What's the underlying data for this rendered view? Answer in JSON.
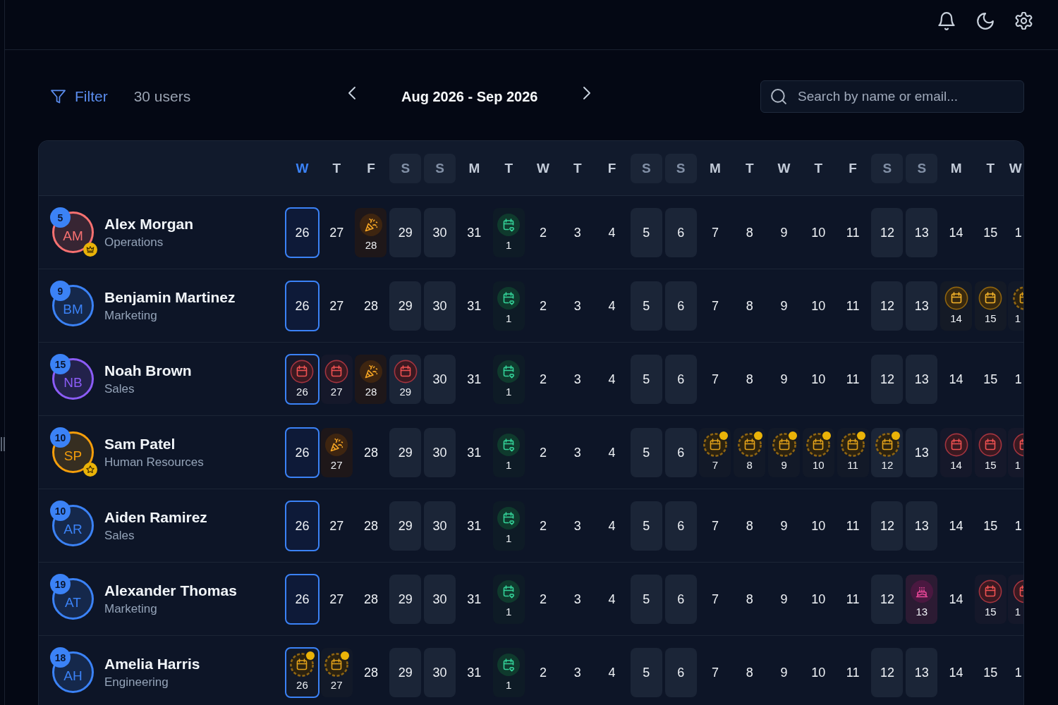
{
  "toolbar": {
    "filter_label": "Filter",
    "user_count": "30 users",
    "date_range": "Aug 2026 - Sep 2026",
    "search": {
      "placeholder": "Search by name or email..."
    }
  },
  "days": [
    {
      "letter": "W",
      "weekend": false,
      "today": true
    },
    {
      "letter": "T",
      "weekend": false,
      "today": false
    },
    {
      "letter": "F",
      "weekend": false,
      "today": false
    },
    {
      "letter": "S",
      "weekend": true,
      "today": false
    },
    {
      "letter": "S",
      "weekend": true,
      "today": false
    },
    {
      "letter": "M",
      "weekend": false,
      "today": false
    },
    {
      "letter": "T",
      "weekend": false,
      "today": false
    },
    {
      "letter": "W",
      "weekend": false,
      "today": false
    },
    {
      "letter": "T",
      "weekend": false,
      "today": false
    },
    {
      "letter": "F",
      "weekend": false,
      "today": false
    },
    {
      "letter": "S",
      "weekend": true,
      "today": false
    },
    {
      "letter": "S",
      "weekend": true,
      "today": false
    },
    {
      "letter": "M",
      "weekend": false,
      "today": false
    },
    {
      "letter": "T",
      "weekend": false,
      "today": false
    },
    {
      "letter": "W",
      "weekend": false,
      "today": false
    },
    {
      "letter": "T",
      "weekend": false,
      "today": false
    },
    {
      "letter": "F",
      "weekend": false,
      "today": false
    },
    {
      "letter": "S",
      "weekend": true,
      "today": false
    },
    {
      "letter": "S",
      "weekend": true,
      "today": false
    },
    {
      "letter": "M",
      "weekend": false,
      "today": false
    },
    {
      "letter": "T",
      "weekend": false,
      "today": false
    },
    {
      "letter": "W",
      "weekend": false,
      "today": false
    }
  ],
  "users": [
    {
      "initials": "AM",
      "name": "Alex Morgan",
      "department": "Operations",
      "count": "5",
      "color": "#f87171",
      "role_badge": {
        "kind": "crown"
      },
      "cells": [
        {
          "day": "26",
          "kind": "day"
        },
        {
          "day": "27",
          "kind": "day"
        },
        {
          "day": "28",
          "kind": "celebration"
        },
        {
          "day": "29",
          "kind": "day"
        },
        {
          "day": "30",
          "kind": "day"
        },
        {
          "day": "31",
          "kind": "day"
        },
        {
          "day": "1",
          "kind": "holiday"
        },
        {
          "day": "2",
          "kind": "day"
        },
        {
          "day": "3",
          "kind": "day"
        },
        {
          "day": "4",
          "kind": "day"
        },
        {
          "day": "5",
          "kind": "day"
        },
        {
          "day": "6",
          "kind": "day"
        },
        {
          "day": "7",
          "kind": "day"
        },
        {
          "day": "8",
          "kind": "day"
        },
        {
          "day": "9",
          "kind": "day"
        },
        {
          "day": "10",
          "kind": "day"
        },
        {
          "day": "11",
          "kind": "day"
        },
        {
          "day": "12",
          "kind": "day"
        },
        {
          "day": "13",
          "kind": "day"
        },
        {
          "day": "14",
          "kind": "day"
        },
        {
          "day": "15",
          "kind": "day"
        },
        {
          "day": "1",
          "kind": "day"
        }
      ]
    },
    {
      "initials": "BM",
      "name": "Benjamin Martinez",
      "department": "Marketing",
      "count": "9",
      "color": "#3b82f6",
      "cells": [
        {
          "day": "26",
          "kind": "day"
        },
        {
          "day": "27",
          "kind": "day"
        },
        {
          "day": "28",
          "kind": "day"
        },
        {
          "day": "29",
          "kind": "day"
        },
        {
          "day": "30",
          "kind": "day"
        },
        {
          "day": "31",
          "kind": "day"
        },
        {
          "day": "1",
          "kind": "holiday"
        },
        {
          "day": "2",
          "kind": "day"
        },
        {
          "day": "3",
          "kind": "day"
        },
        {
          "day": "4",
          "kind": "day"
        },
        {
          "day": "5",
          "kind": "day"
        },
        {
          "day": "6",
          "kind": "day"
        },
        {
          "day": "7",
          "kind": "day"
        },
        {
          "day": "8",
          "kind": "day"
        },
        {
          "day": "9",
          "kind": "day"
        },
        {
          "day": "10",
          "kind": "day"
        },
        {
          "day": "11",
          "kind": "day"
        },
        {
          "day": "12",
          "kind": "day"
        },
        {
          "day": "13",
          "kind": "day"
        },
        {
          "day": "14",
          "kind": "vacation"
        },
        {
          "day": "15",
          "kind": "vacation"
        },
        {
          "day": "1",
          "kind": "pending"
        }
      ]
    },
    {
      "initials": "NB",
      "name": "Noah Brown",
      "department": "Sales",
      "count": "15",
      "color": "#8b5cf6",
      "cells": [
        {
          "day": "26",
          "kind": "leave"
        },
        {
          "day": "27",
          "kind": "leave"
        },
        {
          "day": "28",
          "kind": "celebration"
        },
        {
          "day": "29",
          "kind": "leave"
        },
        {
          "day": "30",
          "kind": "day"
        },
        {
          "day": "31",
          "kind": "day"
        },
        {
          "day": "1",
          "kind": "holiday"
        },
        {
          "day": "2",
          "kind": "day"
        },
        {
          "day": "3",
          "kind": "day"
        },
        {
          "day": "4",
          "kind": "day"
        },
        {
          "day": "5",
          "kind": "day"
        },
        {
          "day": "6",
          "kind": "day"
        },
        {
          "day": "7",
          "kind": "day"
        },
        {
          "day": "8",
          "kind": "day"
        },
        {
          "day": "9",
          "kind": "day"
        },
        {
          "day": "10",
          "kind": "day"
        },
        {
          "day": "11",
          "kind": "day"
        },
        {
          "day": "12",
          "kind": "day"
        },
        {
          "day": "13",
          "kind": "day"
        },
        {
          "day": "14",
          "kind": "day"
        },
        {
          "day": "15",
          "kind": "day"
        },
        {
          "day": "1",
          "kind": "day"
        }
      ]
    },
    {
      "initials": "SP",
      "name": "Sam Patel",
      "department": "Human Resources",
      "count": "10",
      "color": "#f59e0b",
      "role_badge": {
        "kind": "star"
      },
      "cells": [
        {
          "day": "26",
          "kind": "day"
        },
        {
          "day": "27",
          "kind": "celebration"
        },
        {
          "day": "28",
          "kind": "day"
        },
        {
          "day": "29",
          "kind": "day"
        },
        {
          "day": "30",
          "kind": "day"
        },
        {
          "day": "31",
          "kind": "day"
        },
        {
          "day": "1",
          "kind": "holiday"
        },
        {
          "day": "2",
          "kind": "day"
        },
        {
          "day": "3",
          "kind": "day"
        },
        {
          "day": "4",
          "kind": "day"
        },
        {
          "day": "5",
          "kind": "day"
        },
        {
          "day": "6",
          "kind": "day"
        },
        {
          "day": "7",
          "kind": "pending"
        },
        {
          "day": "8",
          "kind": "pending"
        },
        {
          "day": "9",
          "kind": "pending"
        },
        {
          "day": "10",
          "kind": "pending"
        },
        {
          "day": "11",
          "kind": "pending"
        },
        {
          "day": "12",
          "kind": "pending"
        },
        {
          "day": "13",
          "kind": "day"
        },
        {
          "day": "14",
          "kind": "leave"
        },
        {
          "day": "15",
          "kind": "leave"
        },
        {
          "day": "1",
          "kind": "leave"
        }
      ]
    },
    {
      "initials": "AR",
      "name": "Aiden Ramirez",
      "department": "Sales",
      "count": "10",
      "color": "#3b82f6",
      "cells": [
        {
          "day": "26",
          "kind": "day"
        },
        {
          "day": "27",
          "kind": "day"
        },
        {
          "day": "28",
          "kind": "day"
        },
        {
          "day": "29",
          "kind": "day"
        },
        {
          "day": "30",
          "kind": "day"
        },
        {
          "day": "31",
          "kind": "day"
        },
        {
          "day": "1",
          "kind": "holiday"
        },
        {
          "day": "2",
          "kind": "day"
        },
        {
          "day": "3",
          "kind": "day"
        },
        {
          "day": "4",
          "kind": "day"
        },
        {
          "day": "5",
          "kind": "day"
        },
        {
          "day": "6",
          "kind": "day"
        },
        {
          "day": "7",
          "kind": "day"
        },
        {
          "day": "8",
          "kind": "day"
        },
        {
          "day": "9",
          "kind": "day"
        },
        {
          "day": "10",
          "kind": "day"
        },
        {
          "day": "11",
          "kind": "day"
        },
        {
          "day": "12",
          "kind": "day"
        },
        {
          "day": "13",
          "kind": "day"
        },
        {
          "day": "14",
          "kind": "day"
        },
        {
          "day": "15",
          "kind": "day"
        },
        {
          "day": "1",
          "kind": "day"
        }
      ]
    },
    {
      "initials": "AT",
      "name": "Alexander Thomas",
      "department": "Marketing",
      "count": "19",
      "color": "#3b82f6",
      "cells": [
        {
          "day": "26",
          "kind": "day"
        },
        {
          "day": "27",
          "kind": "day"
        },
        {
          "day": "28",
          "kind": "day"
        },
        {
          "day": "29",
          "kind": "day"
        },
        {
          "day": "30",
          "kind": "day"
        },
        {
          "day": "31",
          "kind": "day"
        },
        {
          "day": "1",
          "kind": "holiday"
        },
        {
          "day": "2",
          "kind": "day"
        },
        {
          "day": "3",
          "kind": "day"
        },
        {
          "day": "4",
          "kind": "day"
        },
        {
          "day": "5",
          "kind": "day"
        },
        {
          "day": "6",
          "kind": "day"
        },
        {
          "day": "7",
          "kind": "day"
        },
        {
          "day": "8",
          "kind": "day"
        },
        {
          "day": "9",
          "kind": "day"
        },
        {
          "day": "10",
          "kind": "day"
        },
        {
          "day": "11",
          "kind": "day"
        },
        {
          "day": "12",
          "kind": "day"
        },
        {
          "day": "13",
          "kind": "birthday"
        },
        {
          "day": "14",
          "kind": "day"
        },
        {
          "day": "15",
          "kind": "leave"
        },
        {
          "day": "1",
          "kind": "leave"
        }
      ]
    },
    {
      "initials": "AH",
      "name": "Amelia Harris",
      "department": "Engineering",
      "count": "18",
      "color": "#3b82f6",
      "cells": [
        {
          "day": "26",
          "kind": "pending"
        },
        {
          "day": "27",
          "kind": "pending"
        },
        {
          "day": "28",
          "kind": "day"
        },
        {
          "day": "29",
          "kind": "day"
        },
        {
          "day": "30",
          "kind": "day"
        },
        {
          "day": "31",
          "kind": "day"
        },
        {
          "day": "1",
          "kind": "holiday"
        },
        {
          "day": "2",
          "kind": "day"
        },
        {
          "day": "3",
          "kind": "day"
        },
        {
          "day": "4",
          "kind": "day"
        },
        {
          "day": "5",
          "kind": "day"
        },
        {
          "day": "6",
          "kind": "day"
        },
        {
          "day": "7",
          "kind": "day"
        },
        {
          "day": "8",
          "kind": "day"
        },
        {
          "day": "9",
          "kind": "day"
        },
        {
          "day": "10",
          "kind": "day"
        },
        {
          "day": "11",
          "kind": "day"
        },
        {
          "day": "12",
          "kind": "day"
        },
        {
          "day": "13",
          "kind": "day"
        },
        {
          "day": "14",
          "kind": "day"
        },
        {
          "day": "15",
          "kind": "day"
        },
        {
          "day": "1",
          "kind": "day"
        }
      ]
    }
  ]
}
